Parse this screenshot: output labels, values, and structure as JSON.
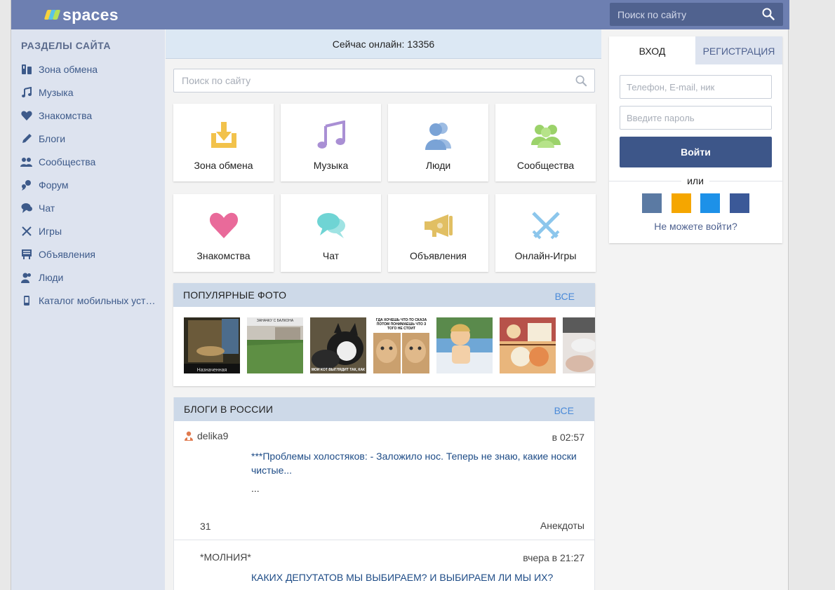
{
  "header": {
    "logo_text": "spaces",
    "search_placeholder": "Поиск по сайту"
  },
  "sidebar": {
    "title": "РАЗДЕЛЫ САЙТА",
    "items": [
      {
        "label": "Зона обмена",
        "icon": "exchange-icon"
      },
      {
        "label": "Музыка",
        "icon": "music-note-icon"
      },
      {
        "label": "Знакомства",
        "icon": "heart-icon"
      },
      {
        "label": "Блоги",
        "icon": "pen-icon"
      },
      {
        "label": "Сообщества",
        "icon": "community-icon"
      },
      {
        "label": "Форум",
        "icon": "forum-icon"
      },
      {
        "label": "Чат",
        "icon": "chat-icon"
      },
      {
        "label": "Игры",
        "icon": "crossed-swords-icon"
      },
      {
        "label": "Объявления",
        "icon": "ads-board-icon"
      },
      {
        "label": "Люди",
        "icon": "people-icon"
      },
      {
        "label": "Каталог мобильных устройств",
        "icon": "mobile-phone-icon"
      }
    ]
  },
  "main": {
    "online_text": "Сейчас онлайн: 13356",
    "search_placeholder": "Поиск по сайту",
    "tiles": [
      {
        "label": "Зона обмена",
        "icon": "download-tray-icon",
        "color": "#f2c24b"
      },
      {
        "label": "Музыка",
        "icon": "music-note-icon",
        "color": "#a98fd4"
      },
      {
        "label": "Люди",
        "icon": "people-icon",
        "color": "#7aa3d6"
      },
      {
        "label": "Сообщества",
        "icon": "community-icon",
        "color": "#9bd26a"
      },
      {
        "label": "Знакомства",
        "icon": "heart-icon",
        "color": "#e96a9a"
      },
      {
        "label": "Чат",
        "icon": "chat-bubbles-icon",
        "color": "#6fd4d4"
      },
      {
        "label": "Объявления",
        "icon": "megaphone-icon",
        "color": "#e1bf63"
      },
      {
        "label": "Онлайн-Игры",
        "icon": "crossed-swords-icon",
        "color": "#8cc6ec"
      }
    ],
    "photos": {
      "title": "ПОПУЛЯРНЫЕ ФОТО",
      "all_label": "ВСЕ",
      "items": [
        {
          "caption": "",
          "bottom_text": "Назначенная"
        },
        {
          "caption": "ЗАНАЧКУ С БАЛКОНА",
          "bottom_text": ""
        },
        {
          "caption": "",
          "bottom_text": "МОИ КОТ ВЫГЛЯДИТ ТАК, КАК"
        },
        {
          "caption": "ГДА ХОЧЕШЬ ЧТО-ТО СКАЗА ПОТОМ ПОНИМАЕШЬ ЧТО З ТОГО НЕ СТОИТ",
          "bottom_text": ""
        },
        {
          "caption": "",
          "bottom_text": ""
        },
        {
          "caption": "",
          "bottom_text": ""
        },
        {
          "caption": "",
          "bottom_text": ""
        }
      ]
    },
    "blogs": {
      "title": "БЛОГИ В РОССИИ",
      "all_label": "ВСЕ",
      "posts": [
        {
          "author": "delika9",
          "time": "в 02:57",
          "text": "***Проблемы холостяков: - Заложило нос. Теперь не знаю, какие носки чистые...",
          "more": "...",
          "count": "31",
          "category": "Анекдоты"
        },
        {
          "author": "*МОЛНИЯ*",
          "time": "вчера в 21:27",
          "text": "КАКИХ ДЕПУТАТОВ МЫ ВЫБИРАЕМ? И ВЫБИРАЕМ ЛИ МЫ ИХ?"
        }
      ]
    }
  },
  "login": {
    "tab_login": "ВХОД",
    "tab_register": "РЕГИСТРАЦИЯ",
    "login_placeholder": "Телефон, E-mail, ник",
    "password_placeholder": "Введите пароль",
    "submit_label": "Войти",
    "or_text": "или",
    "socials": [
      {
        "name": "vk-icon",
        "color": "#5b7aa3"
      },
      {
        "name": "odnoklassniki-icon",
        "color": "#f5a600"
      },
      {
        "name": "twitter-icon",
        "color": "#1d91e8"
      },
      {
        "name": "facebook-icon",
        "color": "#3b5998"
      }
    ],
    "forgot_label": "Не можете войти?"
  },
  "colors": {
    "header": "#6d7fb1",
    "sidebar": "#dde3ef",
    "link": "#3d5a8a",
    "accent": "#4a8ad8",
    "button": "#3d5689"
  }
}
